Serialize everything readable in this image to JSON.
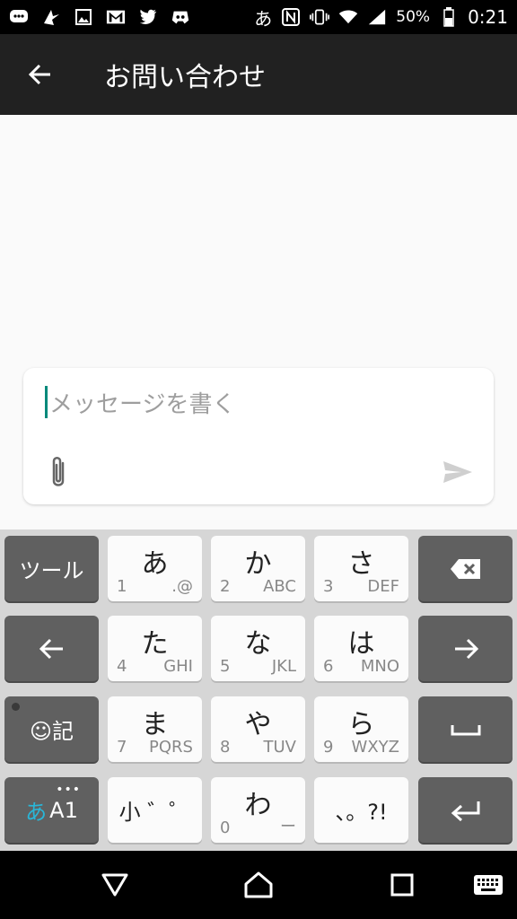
{
  "status_bar": {
    "ime_indicator": "あ",
    "battery_percent": "50%",
    "time": "0:21",
    "icons": [
      "message-icon",
      "bird-icon",
      "image-icon",
      "gmail-icon",
      "twitter-icon",
      "discord-icon",
      "nfc-icon",
      "vibrate-icon",
      "wifi-icon",
      "signal-icon",
      "battery-icon"
    ]
  },
  "app_bar": {
    "title": "お問い合わせ"
  },
  "compose": {
    "placeholder": "メッセージを書く"
  },
  "keyboard": {
    "tool_label": "ツール",
    "emoji_label": "☺記",
    "mode_label_kana": "あ",
    "mode_label_alpha": "A1",
    "row1": [
      {
        "main": "あ",
        "num": "1",
        "sub": ".@"
      },
      {
        "main": "か",
        "num": "2",
        "sub": "ABC"
      },
      {
        "main": "さ",
        "num": "3",
        "sub": "DEF"
      }
    ],
    "row2": [
      {
        "main": "た",
        "num": "4",
        "sub": "GHI"
      },
      {
        "main": "な",
        "num": "5",
        "sub": "JKL"
      },
      {
        "main": "は",
        "num": "6",
        "sub": "MNO"
      }
    ],
    "row3": [
      {
        "main": "ま",
        "num": "7",
        "sub": "PQRS"
      },
      {
        "main": "や",
        "num": "8",
        "sub": "TUV"
      },
      {
        "main": "ら",
        "num": "9",
        "sub": "WXYZ"
      }
    ],
    "row4": [
      {
        "main": "小 ゛゜",
        "num": "",
        "sub": ""
      },
      {
        "main": "わ",
        "num": "0",
        "sub": "ー"
      },
      {
        "main": "、。?!",
        "num": "",
        "sub": ""
      }
    ]
  },
  "colors": {
    "accent": "#00897b",
    "app_bar": "#212121",
    "kana_mode": "#29b6d8"
  }
}
